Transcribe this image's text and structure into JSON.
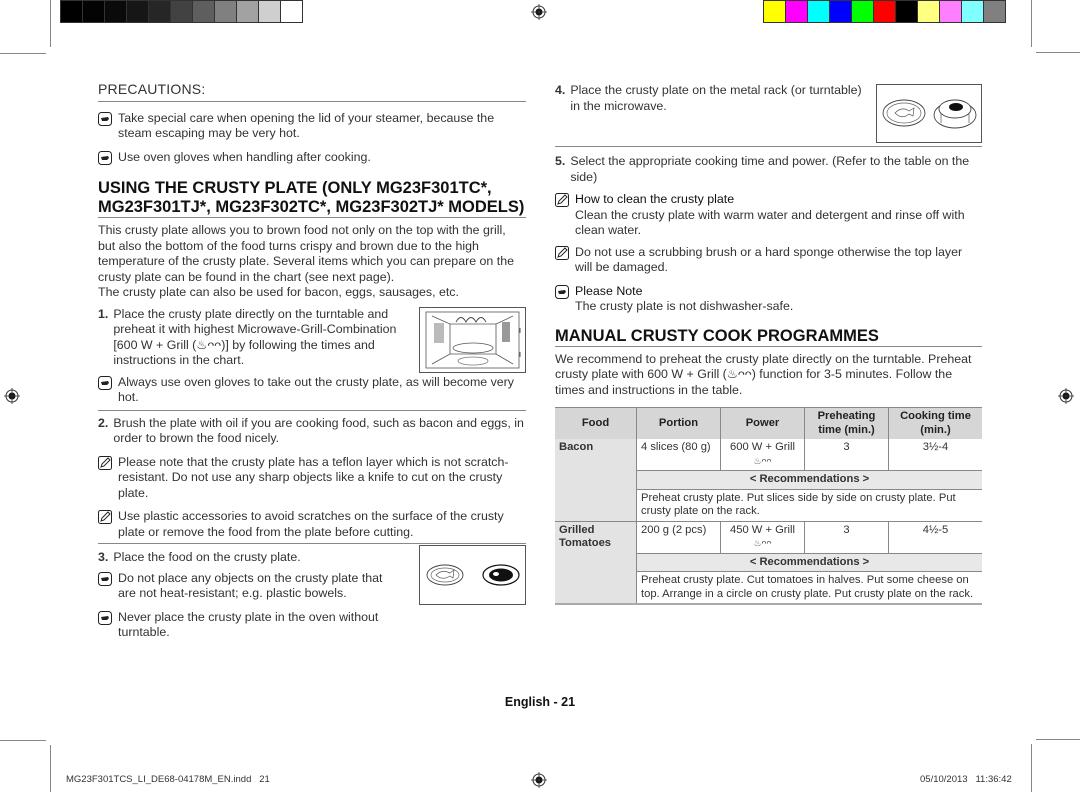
{
  "print_marks": {
    "gray_swatches": [
      "#000000",
      "#030303",
      "#0a0a0a",
      "#161616",
      "#262626",
      "#424242",
      "#5e5e5e",
      "#808080",
      "#a2a2a2",
      "#cfcfcf",
      "#ffffff"
    ],
    "color_swatches": [
      "#ffff00",
      "#ff00ff",
      "#00ffff",
      "#0000ff",
      "#00ff00",
      "#ff0000",
      "#000000",
      "#ffff80",
      "#ff80ff",
      "#80ffff",
      "#808080"
    ]
  },
  "left": {
    "precautions_title": "PRECAUTIONS:",
    "precautions": [
      "Take special care when opening the lid of your steamer, because the steam escaping may be very hot.",
      "Use oven gloves when handling after cooking."
    ],
    "section_title_line1": "USING THE CRUSTY PLATE (ONLY MG23F301TC*,",
    "section_title_line2": "MG23F301TJ*, MG23F302TC*, MG23F302TJ* MODELS)",
    "intro": "This crusty plate allows you to brown food not only on the top with the grill, but also the bottom of the food turns crispy and brown due to the high temperature of the crusty plate. Several items which you can prepare on the crusty plate can be found in the chart (see next page).",
    "intro2": "The crusty plate can also be used for bacon, eggs, sausages, etc.",
    "step1_num": "1.",
    "step1": "Place the crusty plate directly on the turntable and preheat it with highest Microwave-Grill-Combination [600 W + Grill (♨︎ᴖᴖ)] by following the times and instructions in the chart.",
    "step1_note": "Always use oven gloves to take out the crusty plate, as will become very hot.",
    "step2_num": "2.",
    "step2": "Brush the plate with oil if you are cooking food, such as bacon and eggs, in order to brown the food nicely.",
    "step2_notes": [
      "Please note that the crusty plate has a teflon layer which is not scratch-resistant. Do not use any sharp objects like a knife to cut on the crusty plate.",
      "Use plastic accessories to avoid scratches on the surface of the crusty plate or remove the food from the plate before cutting."
    ],
    "step3_num": "3.",
    "step3": "Place the food on the crusty plate.",
    "step3_notes": [
      "Do not place any objects on the crusty plate that are not heat-resistant; e.g. plastic bowels.",
      "Never place the crusty plate in the oven without turntable."
    ]
  },
  "right": {
    "step4_num": "4.",
    "step4": "Place the crusty plate on the metal rack (or turntable) in the microwave.",
    "step5_num": "5.",
    "step5": "Select the appropriate cooking time and power. (Refer to the table on the side)",
    "clean_title": "How to clean the crusty plate",
    "clean_text": "Clean the crusty plate with warm water and detergent and rinse off with clean water.",
    "clean_note": "Do not use a scrubbing brush or a hard sponge otherwise the top layer will be damaged.",
    "please_note_title": "Please Note",
    "please_note_text": "The crusty plate is not dishwasher-safe.",
    "programmes_title": "MANUAL CRUSTY COOK PROGRAMMES",
    "programmes_intro": "We recommend to preheat the crusty plate directly on the turntable. Preheat crusty plate with 600 W + Grill (♨︎ᴖᴖ) function for 3-5 minutes. Follow the times and instructions in the table.",
    "table": {
      "headers": [
        "Food",
        "Portion",
        "Power",
        "Preheating time (min.)",
        "Cooking time (min.)"
      ],
      "recommendations_label": "< Recommendations >",
      "rows": [
        {
          "food": "Bacon",
          "portion": "4 slices (80 g)",
          "power": "600 W + Grill",
          "power_icon": "♨︎ᴖᴖ",
          "preheating": "3",
          "cooking": "3½-4",
          "recommendation": "Preheat crusty plate. Put slices side by side on crusty plate. Put crusty plate on the rack."
        },
        {
          "food": "Grilled Tomatoes",
          "portion": "200 g (2 pcs)",
          "power": "450 W + Grill",
          "power_icon": "♨︎ᴖᴖ",
          "preheating": "3",
          "cooking": "4½-5",
          "recommendation": "Preheat crusty plate. Cut tomatoes in halves. Put some cheese on top. Arrange in a circle on crusty plate. Put crusty plate on the rack."
        }
      ]
    }
  },
  "footer": {
    "page_label": "English - 21",
    "file_name": "MG23F301TCS_LI_DE68-04178M_EN.indd   21",
    "timestamp": "05/10/2013   11:36:42"
  }
}
